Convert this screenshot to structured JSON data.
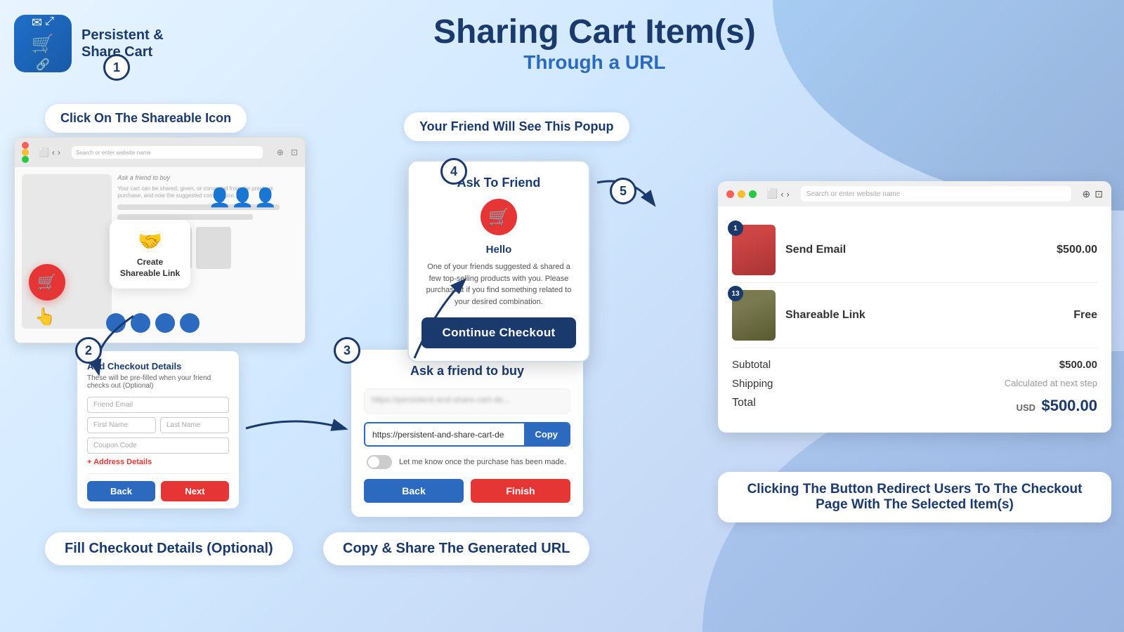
{
  "header": {
    "logo_line1": "Persistent &",
    "logo_line2": "Share Cart",
    "page_title": "Sharing Cart Item(s)",
    "page_subtitle": "Through a URL"
  },
  "callouts": {
    "click_icon": "Click On The Shareable Icon",
    "popup_label": "Your Friend Will See This Popup",
    "fill_checkout": "Fill Checkout Details (Optional)",
    "copy_share": "Copy & Share The Generated URL",
    "redirect_info": "Clicking The Button Redirect Users To The Checkout Page With The Selected Item(s)"
  },
  "steps": {
    "step1": "1",
    "step2": "2",
    "step3": "3",
    "step4": "4",
    "step5": "5"
  },
  "create_link_box": {
    "label": "Create Shareable Link"
  },
  "checkout_form": {
    "title": "Add Checkout Details",
    "subtitle": "These will be pre-filled when your friend checks out (Optional)",
    "field_email": "Friend Email",
    "field_firstname": "First Name",
    "field_lastname": "Last Name",
    "field_coupon": "Coupon Code",
    "address_toggle": "+ Address Details",
    "btn_back": "Back",
    "btn_next": "Next"
  },
  "share_panel": {
    "title": "Ask a friend to buy",
    "url_value": "https://persistent-and-share-cart-de",
    "url_placeholder": "https://persistent-and-share-cart-de",
    "btn_copy": "Copy",
    "toggle_label": "Let me know once the purchase has been made.",
    "btn_back": "Back",
    "btn_finish": "Finish"
  },
  "ask_friend_popup": {
    "title": "Ask To Friend",
    "greeting": "Hello",
    "message": "One of your friends suggested & shared a few top-selling products with you. Please purchase it if you find something related to your desired combination.",
    "btn_continue": "Continue Checkout"
  },
  "browser_cart": {
    "search_placeholder": "Search or enter website name",
    "item1_name": "Send Email",
    "item1_price": "$500.00",
    "item1_badge": "1",
    "item2_name": "Shareable Link",
    "item2_price": "Free",
    "item2_badge": "13",
    "subtotal_label": "Subtotal",
    "subtotal_value": "$500.00",
    "shipping_label": "Shipping",
    "shipping_value": "Calculated at next step",
    "total_label": "Total",
    "total_currency": "USD",
    "total_value": "$500.00"
  },
  "colors": {
    "primary_dark": "#1a3a6e",
    "primary_blue": "#2c6abf",
    "red": "#e63535",
    "bg": "#d8eaf8"
  }
}
